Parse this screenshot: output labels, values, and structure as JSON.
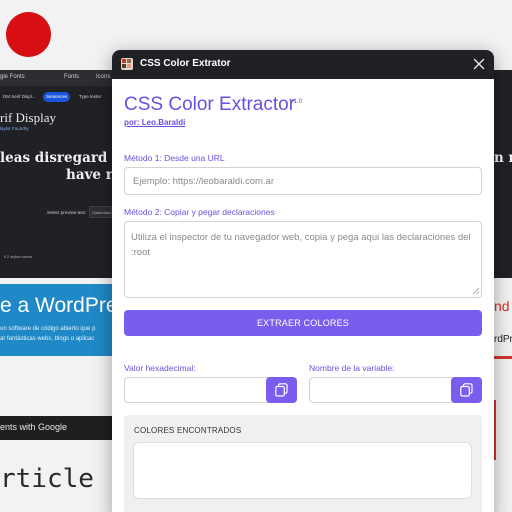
{
  "background": {
    "google_fonts": {
      "brand": "gle Fonts",
      "nav_tab_1": "Fonts",
      "nav_tab_2": "Icons",
      "filter_chips": [
        "DM Serif Displ...",
        "Sentences",
        "Type tester"
      ],
      "font_title": "rif Display",
      "font_author": "laylor Foundry",
      "preview_line_1": "leas disregard and con",
      "preview_line_2": "have res",
      "preview_right": "n ri",
      "select_label": "Select preview text:",
      "select_value": "Customize",
      "footnote": "ll 2 styles below"
    },
    "wordpress": {
      "title": "e a WordPre",
      "subtitle_1": "un software de código abierto que p",
      "subtitle_2": "ar fantásticas webs, blogs o aplicac",
      "right_title": "nd",
      "right_text": "rdPr"
    },
    "google_bar_text": "ents with Google",
    "article_text": "rticle"
  },
  "popup": {
    "window_title": "CSS Color Extrator",
    "heading": "CSS Color Extractor",
    "version": "V1.0",
    "author": "por: Leo.Baraldi",
    "method1_label": "Método 1: Desde una URL",
    "url_placeholder": "Ejemplo: https://leobaraldi.com.ar",
    "method2_label": "Método 2: Copiar y pegar declaraciones",
    "declarations_placeholder": "Utiliza el inspector de tu navegador web, copia y pega aqui las declaraciones del :root",
    "extract_button": "EXTRAER COLORES",
    "hex_label": "Valor hexadecimal:",
    "hex_value": "",
    "varname_label": "Nombre de la variable:",
    "varname_value": "",
    "found_title": "COLORES ENCONTRADOS",
    "icons": {
      "close": "close-icon",
      "copy": "copy-icon",
      "app": "palette-icon"
    },
    "colors": {
      "accent": "#7a5cee",
      "heading": "#6d4fe0",
      "titlebar": "#202124"
    }
  }
}
